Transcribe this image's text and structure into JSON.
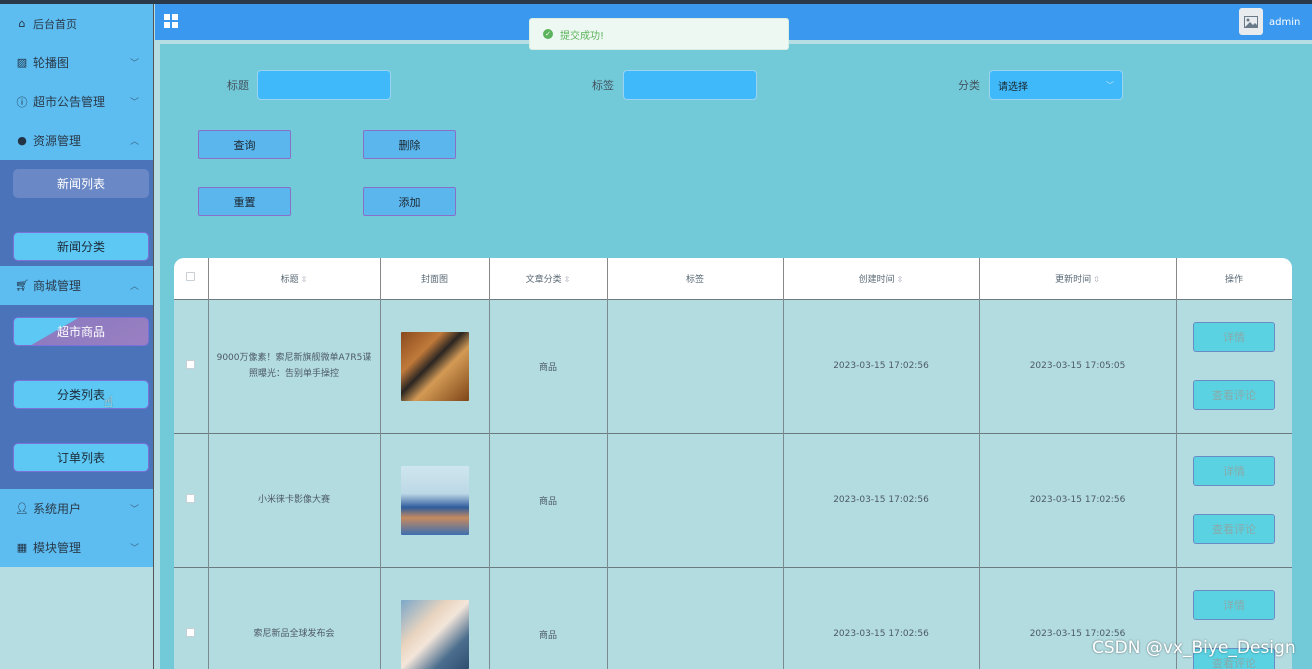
{
  "header": {
    "title": "",
    "username": "admin"
  },
  "toast": {
    "message": "提交成功!"
  },
  "sidebar": {
    "items": [
      {
        "label": "后台首页",
        "icon": "home-icon"
      },
      {
        "label": "轮播图",
        "icon": "image-icon"
      },
      {
        "label": "超市公告管理",
        "icon": "info-icon"
      },
      {
        "label": "资源管理",
        "icon": "pin-icon"
      },
      {
        "label": "商城管理",
        "icon": "cart-icon"
      },
      {
        "label": "系统用户",
        "icon": "user-icon"
      },
      {
        "label": "模块管理",
        "icon": "grid-icon"
      }
    ],
    "resource_sub": [
      "新闻列表",
      "新闻分类"
    ],
    "mall_sub": [
      "超市商品",
      "分类列表",
      "订单列表"
    ]
  },
  "filters": {
    "title_label": "标题",
    "tag_label": "标签",
    "category_label": "分类",
    "category_value": "请选择"
  },
  "buttons": {
    "query": "查询",
    "delete": "删除",
    "reset": "重置",
    "add": "添加"
  },
  "table": {
    "headers": [
      "标题",
      "封面图",
      "文章分类",
      "标签",
      "创建时间",
      "更新时间",
      "操作"
    ],
    "rows": [
      {
        "title": "9000万像素！索尼新旗舰微单A7R5谍照曝光：告别单手操控",
        "category": "商品",
        "tag": "",
        "created": "2023-03-15 17:02:56",
        "updated": "2023-03-15 17:05:05"
      },
      {
        "title": "小米徕卡影像大赛",
        "category": "商品",
        "tag": "",
        "created": "2023-03-15 17:02:56",
        "updated": "2023-03-15 17:02:56"
      },
      {
        "title": "索尼新品全球发布会",
        "category": "商品",
        "tag": "",
        "created": "2023-03-15 17:02:56",
        "updated": "2023-03-15 17:02:56"
      }
    ],
    "detail_label": "详情",
    "comment_label": "查看评论"
  },
  "watermark": "CSDN @vx_Biye_Design"
}
